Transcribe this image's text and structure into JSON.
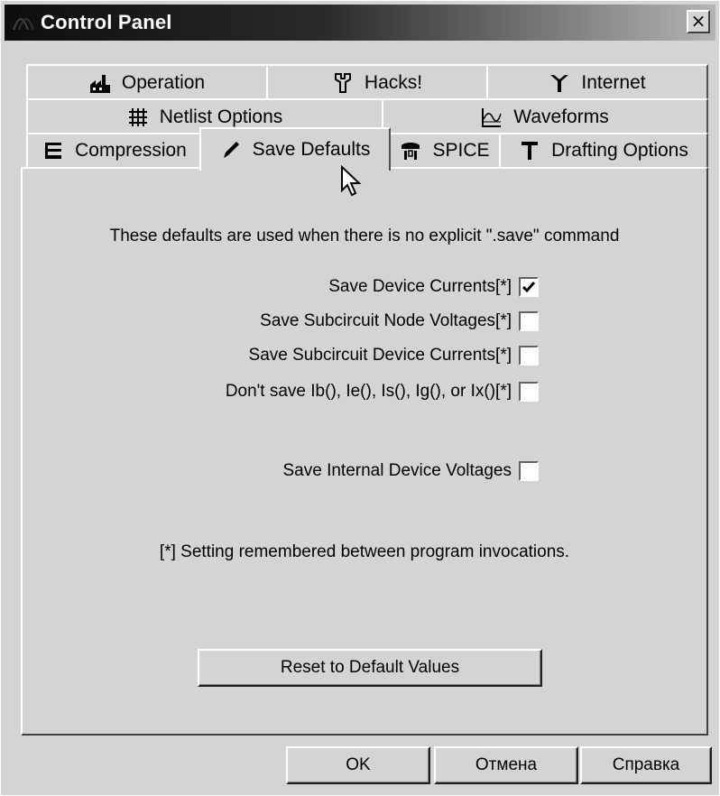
{
  "window": {
    "title": "Control Panel",
    "close_glyph": "×"
  },
  "tabs": {
    "row1": [
      {
        "label": "Operation",
        "icon": "factory-icon"
      },
      {
        "label": "Hacks!",
        "icon": "wrench-icon"
      },
      {
        "label": "Internet",
        "icon": "antenna-icon"
      }
    ],
    "row2": [
      {
        "label": "Netlist Options",
        "icon": "grid-icon"
      },
      {
        "label": "Waveforms",
        "icon": "waveform-icon"
      }
    ],
    "row3": [
      {
        "label": "Compression",
        "icon": "compression-clamp-icon"
      },
      {
        "label": "Save Defaults",
        "icon": "pen-icon",
        "active": true
      },
      {
        "label": "SPICE",
        "icon": "spice-icon"
      },
      {
        "label": "Drafting Options",
        "icon": "drafting-t-icon"
      }
    ]
  },
  "panel": {
    "intro": "These defaults are used when there is no explicit \".save\" command",
    "options": [
      {
        "label": "Save Device Currents[*]",
        "checked": true
      },
      {
        "label": "Save Subcircuit Node Voltages[*]",
        "checked": false
      },
      {
        "label": "Save Subcircuit Device Currents[*]",
        "checked": false
      },
      {
        "label": "Don't save Ib(), Ie(), Is(), Ig(), or Ix()[*]",
        "checked": false
      },
      {
        "label": "Save Internal Device Voltages",
        "checked": false
      }
    ],
    "note": "[*] Setting remembered between program invocations.",
    "reset_label": "Reset to Default Values"
  },
  "buttons": {
    "ok": "OK",
    "cancel": "Отмена",
    "help": "Справка"
  },
  "colors": {
    "face": "#d4d4d4",
    "highlight": "#ffffff",
    "shadow": "#404040",
    "title_dark": "#0d0d0d"
  }
}
